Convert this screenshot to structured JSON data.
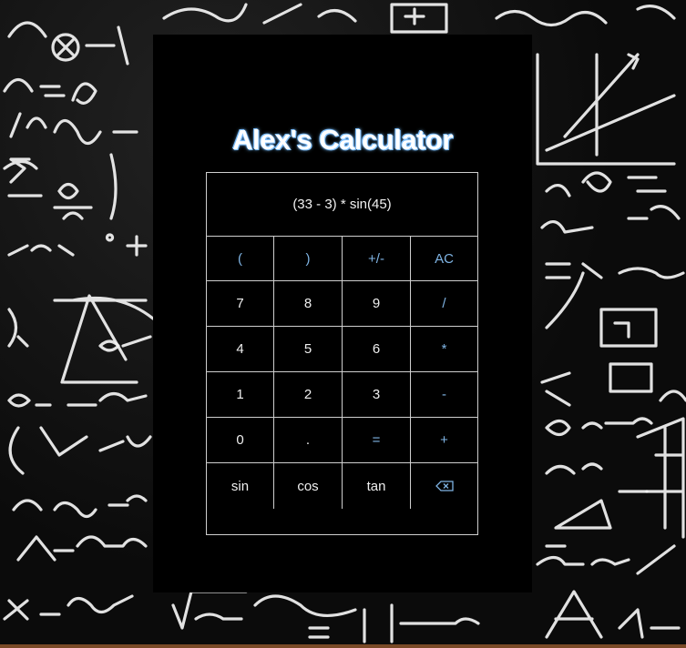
{
  "page": {
    "title": "Alex's Calculator"
  },
  "display": {
    "expression": "(33 - 3) * sin(45)"
  },
  "keys": [
    {
      "label": "(",
      "name": "key-open-paren",
      "style": "blue"
    },
    {
      "label": ")",
      "name": "key-close-paren",
      "style": "blue"
    },
    {
      "label": "+/-",
      "name": "key-negate",
      "style": "blue"
    },
    {
      "label": "AC",
      "name": "key-all-clear",
      "style": "blue"
    },
    {
      "label": "7",
      "name": "key-7",
      "style": "plain"
    },
    {
      "label": "8",
      "name": "key-8",
      "style": "plain"
    },
    {
      "label": "9",
      "name": "key-9",
      "style": "plain"
    },
    {
      "label": "/",
      "name": "key-divide",
      "style": "blue"
    },
    {
      "label": "4",
      "name": "key-4",
      "style": "plain"
    },
    {
      "label": "5",
      "name": "key-5",
      "style": "plain"
    },
    {
      "label": "6",
      "name": "key-6",
      "style": "plain"
    },
    {
      "label": "*",
      "name": "key-multiply",
      "style": "blue"
    },
    {
      "label": "1",
      "name": "key-1",
      "style": "plain"
    },
    {
      "label": "2",
      "name": "key-2",
      "style": "plain"
    },
    {
      "label": "3",
      "name": "key-3",
      "style": "plain"
    },
    {
      "label": "-",
      "name": "key-subtract",
      "style": "blue"
    },
    {
      "label": "0",
      "name": "key-0",
      "style": "plain"
    },
    {
      "label": ".",
      "name": "key-decimal",
      "style": "plain"
    },
    {
      "label": "=",
      "name": "key-equals",
      "style": "blue"
    },
    {
      "label": "+",
      "name": "key-add",
      "style": "blue"
    },
    {
      "label": "sin",
      "name": "key-sin",
      "style": "plain"
    },
    {
      "label": "cos",
      "name": "key-cos",
      "style": "plain"
    },
    {
      "label": "tan",
      "name": "key-tan",
      "style": "plain"
    },
    {
      "label": "",
      "name": "key-backspace",
      "style": "blue",
      "icon": "backspace-icon"
    }
  ],
  "colors": {
    "key_accent": "#7fb4e4",
    "title_glow": "#7fc0ff",
    "panel": "#000000"
  }
}
